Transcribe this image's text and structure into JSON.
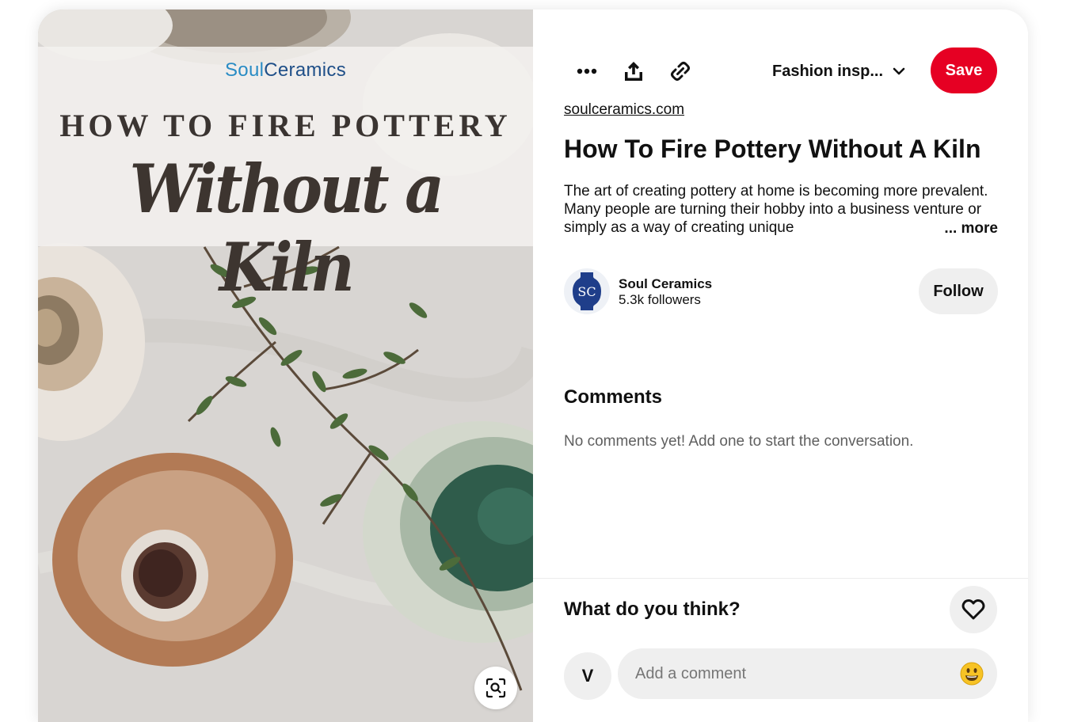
{
  "image": {
    "brand_part1": "Soul",
    "brand_part2": "Ceramics",
    "headline_line1": "HOW TO FIRE POTTERY",
    "headline_line2": "Without a Kiln"
  },
  "toolbar": {
    "more_icon": "ellipsis-icon",
    "share_icon": "share-icon",
    "link_icon": "link-icon",
    "board_name": "Fashion insp...",
    "save_label": "Save"
  },
  "pin": {
    "source_link": "soulceramics.com",
    "title": "How To Fire Pottery Without A Kiln",
    "description": "The art of creating pottery at home is becoming more prevalent. Many people are turning their hobby into a business venture or simply as a way of creating unique",
    "more_label": "... more"
  },
  "creator": {
    "name": "Soul Ceramics",
    "followers": "5.3k followers",
    "follow_label": "Follow"
  },
  "comments": {
    "heading": "Comments",
    "empty_text": "No comments yet! Add one to start the conversation."
  },
  "reaction": {
    "prompt": "What do you think?"
  },
  "composer": {
    "user_initial": "V",
    "placeholder": "Add a comment"
  },
  "colors": {
    "save_red": "#e60023",
    "brand_light_blue": "#2a8cc4",
    "brand_dark_blue": "#1f4f88",
    "button_gray": "#efefef"
  }
}
